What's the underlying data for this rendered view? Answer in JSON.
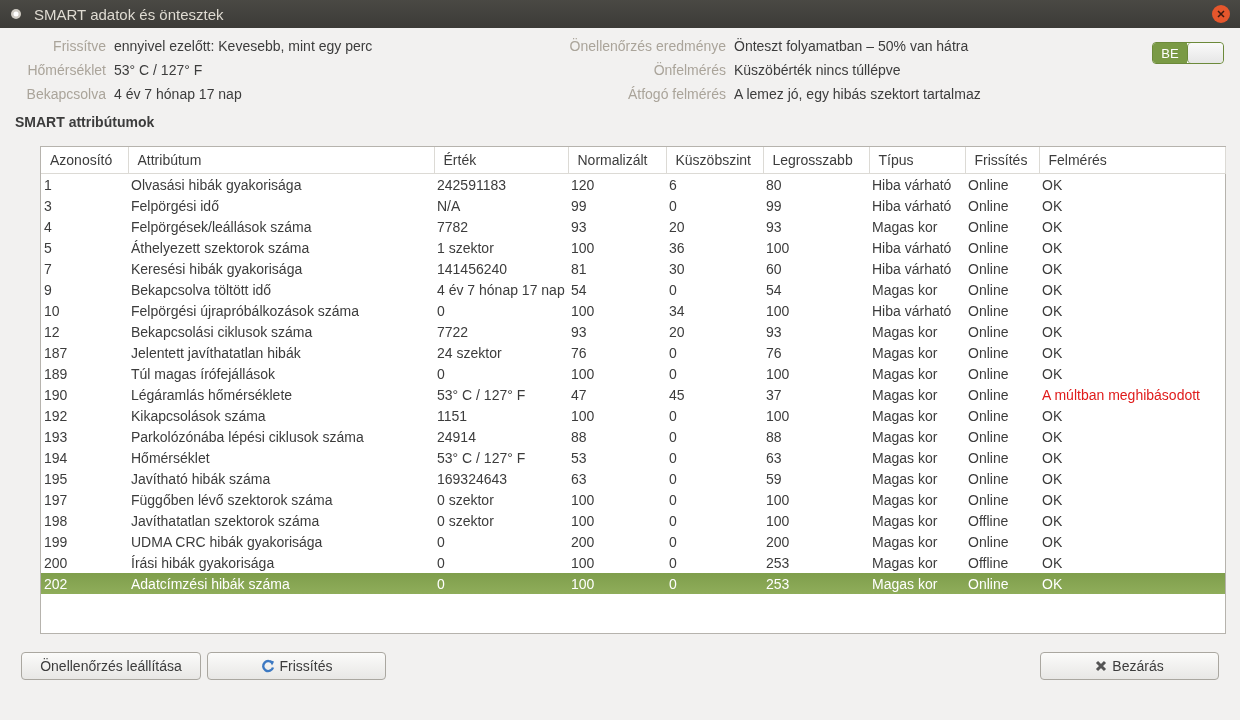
{
  "window": {
    "title": "SMART adatok és öntesztek"
  },
  "info_left": [
    {
      "label": "Frissítve",
      "value": "ennyivel ezelőtt: Kevesebb, mint egy perc"
    },
    {
      "label": "Hőmérséklet",
      "value": "53° C / 127° F"
    },
    {
      "label": "Bekapcsolva",
      "value": "4 év 7 hónap 17 nap"
    }
  ],
  "info_right": [
    {
      "label": "Önellenőrzés eredménye",
      "value": "Önteszt folyamatban – 50% van hátra"
    },
    {
      "label": "Önfelmérés",
      "value": "Küszöbérték nincs túllépve"
    },
    {
      "label": "Átfogó felmérés",
      "value": "A lemez jó, egy hibás szektort tartalmaz"
    }
  ],
  "smart_switch": {
    "label": "BE",
    "on": true
  },
  "section_title": "SMART attribútumok",
  "table": {
    "columns": [
      "Azonosító",
      "Attribútum",
      "Érték",
      "Normalizált",
      "Küszöbszint",
      "Legrosszabb",
      "Típus",
      "Frissítés",
      "Felmérés"
    ],
    "rows": [
      {
        "cells": [
          "1",
          "Olvasási hibák gyakorisága",
          "242591183",
          "120",
          "6",
          "80",
          "Hiba várható",
          "Online",
          "OK"
        ],
        "failed": false,
        "selected": false
      },
      {
        "cells": [
          "3",
          "Felpörgési idő",
          "N/A",
          "99",
          "0",
          "99",
          "Hiba várható",
          "Online",
          "OK"
        ],
        "failed": false,
        "selected": false
      },
      {
        "cells": [
          "4",
          "Felpörgések/leállások száma",
          "7782",
          "93",
          "20",
          "93",
          "Magas kor",
          "Online",
          "OK"
        ],
        "failed": false,
        "selected": false
      },
      {
        "cells": [
          "5",
          "Áthelyezett szektorok száma",
          "1 szektor",
          "100",
          "36",
          "100",
          "Hiba várható",
          "Online",
          "OK"
        ],
        "failed": false,
        "selected": false
      },
      {
        "cells": [
          "7",
          "Keresési hibák gyakorisága",
          "141456240",
          "81",
          "30",
          "60",
          "Hiba várható",
          "Online",
          "OK"
        ],
        "failed": false,
        "selected": false
      },
      {
        "cells": [
          "9",
          "Bekapcsolva töltött idő",
          "4 év 7 hónap 17 nap",
          "54",
          "0",
          "54",
          "Magas kor",
          "Online",
          "OK"
        ],
        "failed": false,
        "selected": false
      },
      {
        "cells": [
          "10",
          "Felpörgési újrapróbálkozások száma",
          "0",
          "100",
          "34",
          "100",
          "Hiba várható",
          "Online",
          "OK"
        ],
        "failed": false,
        "selected": false
      },
      {
        "cells": [
          "12",
          "Bekapcsolási ciklusok száma",
          "7722",
          "93",
          "20",
          "93",
          "Magas kor",
          "Online",
          "OK"
        ],
        "failed": false,
        "selected": false
      },
      {
        "cells": [
          "187",
          "Jelentett javíthatatlan hibák",
          "24 szektor",
          "76",
          "0",
          "76",
          "Magas kor",
          "Online",
          "OK"
        ],
        "failed": false,
        "selected": false
      },
      {
        "cells": [
          "189",
          "Túl magas írófejállások",
          "0",
          "100",
          "0",
          "100",
          "Magas kor",
          "Online",
          "OK"
        ],
        "failed": false,
        "selected": false
      },
      {
        "cells": [
          "190",
          "Légáramlás hőmérséklete",
          "53° C / 127° F",
          "47",
          "45",
          "37",
          "Magas kor",
          "Online",
          "A múltban meghibásodott"
        ],
        "failed": true,
        "selected": false
      },
      {
        "cells": [
          "192",
          "Kikapcsolások száma",
          "1151",
          "100",
          "0",
          "100",
          "Magas kor",
          "Online",
          "OK"
        ],
        "failed": false,
        "selected": false
      },
      {
        "cells": [
          "193",
          "Parkolózónába lépési ciklusok száma",
          "24914",
          "88",
          "0",
          "88",
          "Magas kor",
          "Online",
          "OK"
        ],
        "failed": false,
        "selected": false
      },
      {
        "cells": [
          "194",
          "Hőmérséklet",
          "53° C / 127° F",
          "53",
          "0",
          "63",
          "Magas kor",
          "Online",
          "OK"
        ],
        "failed": false,
        "selected": false
      },
      {
        "cells": [
          "195",
          "Javítható hibák száma",
          "169324643",
          "63",
          "0",
          "59",
          "Magas kor",
          "Online",
          "OK"
        ],
        "failed": false,
        "selected": false
      },
      {
        "cells": [
          "197",
          "Függőben lévő szektorok száma",
          "0 szektor",
          "100",
          "0",
          "100",
          "Magas kor",
          "Online",
          "OK"
        ],
        "failed": false,
        "selected": false
      },
      {
        "cells": [
          "198",
          "Javíthatatlan szektorok száma",
          "0 szektor",
          "100",
          "0",
          "100",
          "Magas kor",
          "Offline",
          "OK"
        ],
        "failed": false,
        "selected": false
      },
      {
        "cells": [
          "199",
          "UDMA CRC hibák gyakorisága",
          "0",
          "200",
          "0",
          "200",
          "Magas kor",
          "Online",
          "OK"
        ],
        "failed": false,
        "selected": false
      },
      {
        "cells": [
          "200",
          "Írási hibák gyakorisága",
          "0",
          "100",
          "0",
          "253",
          "Magas kor",
          "Offline",
          "OK"
        ],
        "failed": false,
        "selected": false
      },
      {
        "cells": [
          "202",
          "Adatcímzési hibák száma",
          "0",
          "100",
          "0",
          "253",
          "Magas kor",
          "Online",
          "OK"
        ],
        "failed": false,
        "selected": true
      }
    ]
  },
  "buttons": [
    {
      "label": "Önellenőrzés leállítása",
      "kind": "plain"
    },
    {
      "label": "Frissítés",
      "kind": "refresh"
    },
    {
      "label": "Bezárás",
      "kind": "close"
    }
  ]
}
